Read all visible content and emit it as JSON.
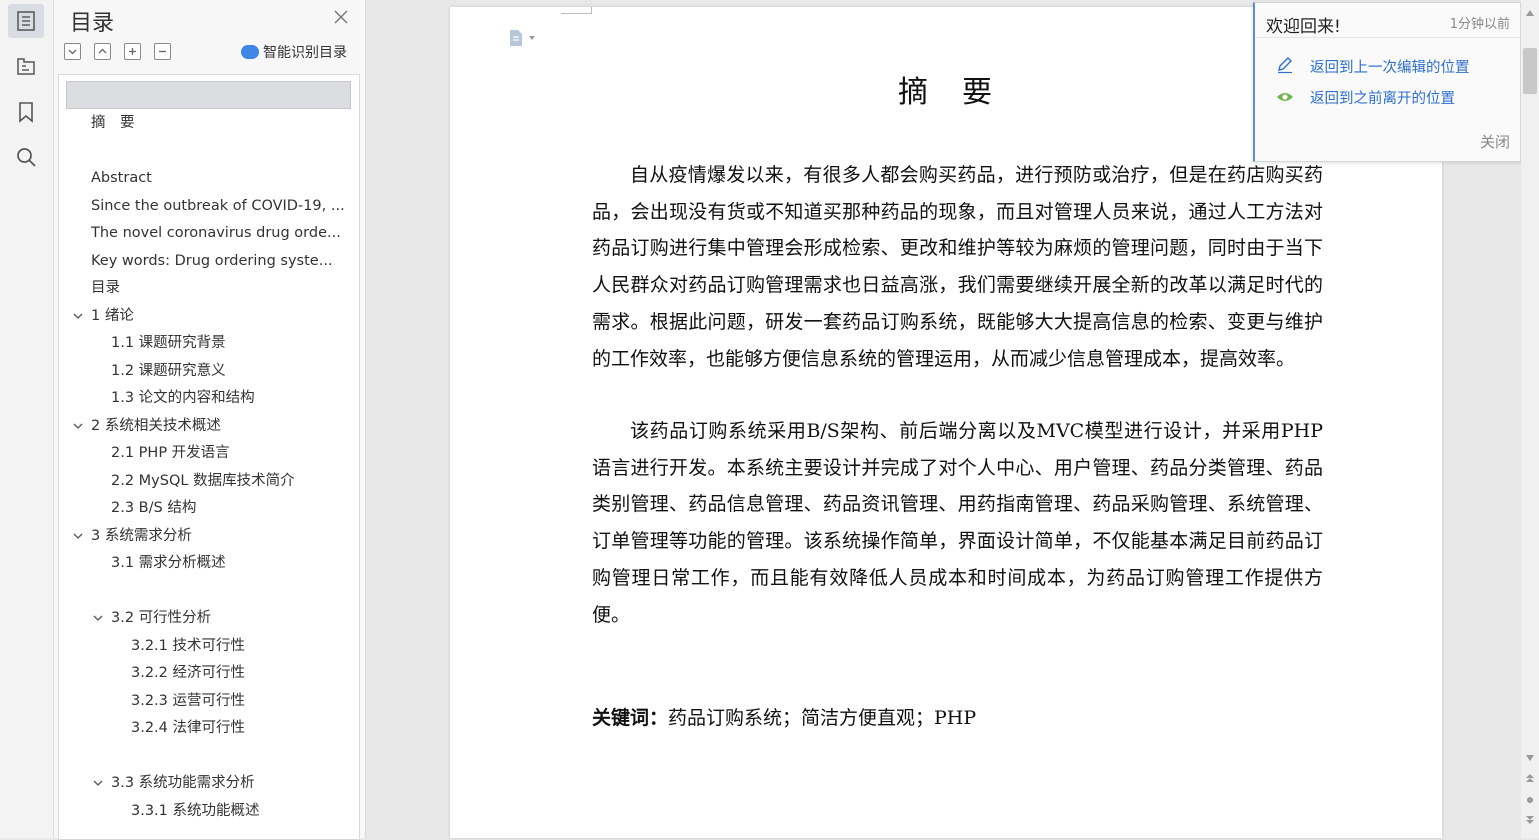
{
  "rail": {
    "icons": [
      "toc-icon",
      "tree-icon",
      "bookmark-icon",
      "search-icon"
    ]
  },
  "toc": {
    "title": "目录",
    "smart_label": "智能识别目录",
    "items": [
      {
        "label": "摘　要",
        "level": 1,
        "expandable": false
      },
      {
        "label": "Abstract",
        "level": 1,
        "expandable": false
      },
      {
        "label": "Since the outbreak of COVID-19, ...",
        "level": 1,
        "expandable": false
      },
      {
        "label": "The novel coronavirus drug orde...",
        "level": 1,
        "expandable": false
      },
      {
        "label": "Key words: Drug ordering syste...",
        "level": 1,
        "expandable": false
      },
      {
        "label": "目录",
        "level": 1,
        "expandable": false
      },
      {
        "label": "1 绪论",
        "level": 1,
        "expandable": true
      },
      {
        "label": "1.1  课题研究背景",
        "level": 2,
        "expandable": false
      },
      {
        "label": "1.2  课题研究意义",
        "level": 2,
        "expandable": false
      },
      {
        "label": "1.3  论文的内容和结构",
        "level": 2,
        "expandable": false
      },
      {
        "label": "2 系统相关技术概述",
        "level": 1,
        "expandable": true
      },
      {
        "label": "2.1 PHP 开发语言",
        "level": 2,
        "expandable": false
      },
      {
        "label": "2.2 MySQL 数据库技术简介",
        "level": 2,
        "expandable": false
      },
      {
        "label": "2.3 B/S 结构",
        "level": 2,
        "expandable": false
      },
      {
        "label": "3 系统需求分析",
        "level": 1,
        "expandable": true
      },
      {
        "label": "3.1 需求分析概述",
        "level": 2,
        "expandable": false
      },
      {
        "label": "3.2 可行性分析",
        "level": 2,
        "expandable": true
      },
      {
        "label": "3.2.1 技术可行性",
        "level": 3,
        "expandable": false
      },
      {
        "label": "3.2.2 经济可行性",
        "level": 3,
        "expandable": false
      },
      {
        "label": "3.2.3 运营可行性",
        "level": 3,
        "expandable": false
      },
      {
        "label": "3.2.4 法律可行性",
        "level": 3,
        "expandable": false
      },
      {
        "label": "3.3 系统功能需求分析",
        "level": 2,
        "expandable": true
      },
      {
        "label": "3.3.1 系统功能概述",
        "level": 3,
        "expandable": false
      }
    ]
  },
  "document": {
    "title": "摘　要",
    "paragraphs": [
      "自从疫情爆发以来，有很多人都会购买药品，进行预防或治疗，但是在药店购买药品，会出现没有货或不知道买那种药品的现象，而且对管理人员来说，通过人工方法对药品订购进行集中管理会形成检索、更改和维护等较为麻烦的管理问题，同时由于当下人民群众对药品订购管理需求也日益高涨，我们需要继续开展全新的改革以满足时代的需求。根据此问题，研发一套药品订购系统，既能够大大提高信息的检索、变更与维护的工作效率，也能够方便信息系统的管理运用，从而减少信息管理成本，提高效率。",
      "该药品订购系统采用B/S架构、前后端分离以及MVC模型进行设计，并采用PHP语言进行开发。本系统主要设计并完成了对个人中心、用户管理、药品分类管理、药品类别管理、药品信息管理、药品资讯管理、用药指南管理、药品采购管理、系统管理、订单管理等功能的管理。该系统操作简单，界面设计简单，不仅能基本满足目前药品订购管理日常工作，而且能有效降低人员成本和时间成本，为药品订购管理工作提供方便。"
    ],
    "keywords_label": "关键词：",
    "keywords": "药品订购系统；简洁方便直观；PHP"
  },
  "popup": {
    "title": "欢迎回来!",
    "time": "1分钟以前",
    "link_edit": "返回到上一次编辑的位置",
    "link_leave": "返回到之前离开的位置",
    "close": "关闭"
  }
}
